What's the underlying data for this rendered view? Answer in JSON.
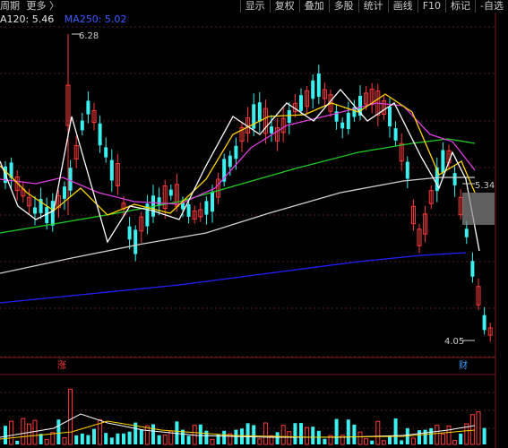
{
  "header": {
    "period_label": "周期",
    "more_label": "更多 〉"
  },
  "toolbar": {
    "items": [
      "显示",
      "复权",
      "叠加",
      "多股",
      "统计",
      "画线",
      "F10",
      "标记",
      "-自选"
    ]
  },
  "legend": {
    "ma120": "A120: 5.46",
    "ma250": "MA250: 5.02"
  },
  "annotations": {
    "high_price": "6.28",
    "low_price": "4.05",
    "current_price": "5.34",
    "marker_zhang": "涨",
    "marker_cai": "财"
  },
  "colors": {
    "up": "#ff3b3b",
    "down": "#3cf0f0",
    "ma_white": "#ffffff",
    "ma_yellow": "#ffd400",
    "ma_magenta": "#e040e0",
    "ma_green": "#22cc22",
    "ma_gray": "#d0d0d0",
    "ma_blue": "#2020ff"
  }
}
